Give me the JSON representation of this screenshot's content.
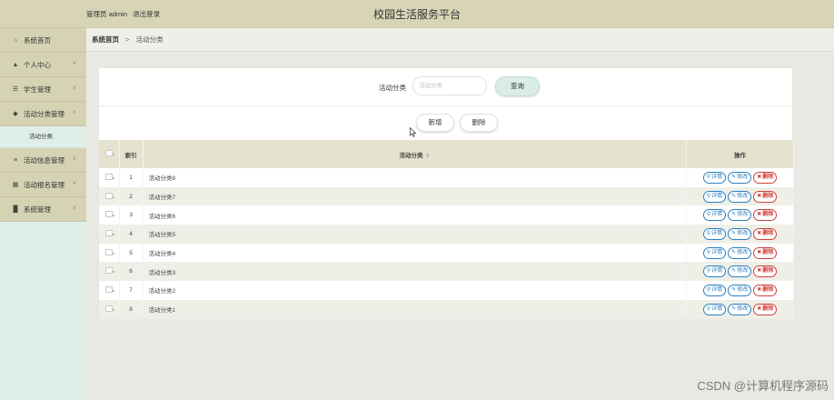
{
  "header": {
    "user_role": "管理员 admin",
    "logout": "退出登录",
    "title": "校园生活服务平台"
  },
  "sidebar": {
    "items": [
      {
        "label": "系统首页",
        "icon": "home-icon",
        "glyph": "⌂"
      },
      {
        "label": "个人中心",
        "icon": "user-icon",
        "glyph": "▴"
      },
      {
        "label": "学生管理",
        "icon": "student-icon",
        "glyph": "≡"
      },
      {
        "label": "活动分类管理",
        "icon": "category-icon",
        "glyph": "◆"
      },
      {
        "label": "活动信息管理",
        "icon": "sliders-icon",
        "glyph": "≣"
      },
      {
        "label": "活动报名管理",
        "icon": "bank-icon",
        "glyph": "⌂"
      },
      {
        "label": "系统管理",
        "icon": "chart-icon",
        "glyph": "▐"
      }
    ],
    "expanded_sub": "活动分类",
    "chevron_down": "∨",
    "chevron_up": "∧"
  },
  "breadcrumb": {
    "home": "系统首页",
    "separator": ">",
    "current": "活动分类"
  },
  "search": {
    "label": "活动分类",
    "placeholder": "活动分类",
    "button": "查询"
  },
  "actions": {
    "add": "新增",
    "delete": "删除"
  },
  "table": {
    "headers": {
      "index": "索引",
      "name": "活动分类",
      "sort_icon": "⇅",
      "ops": "操作"
    },
    "rows": [
      {
        "index": "1",
        "name": "活动分类8"
      },
      {
        "index": "2",
        "name": "活动分类7"
      },
      {
        "index": "3",
        "name": "活动分类6"
      },
      {
        "index": "4",
        "name": "活动分类5"
      },
      {
        "index": "5",
        "name": "活动分类4"
      },
      {
        "index": "6",
        "name": "活动分类3"
      },
      {
        "index": "7",
        "name": "活动分类2"
      },
      {
        "index": "8",
        "name": "活动分类1"
      }
    ],
    "row_actions": {
      "detail": "详情",
      "edit": "修改",
      "delete": "删除"
    }
  },
  "watermark": "CSDN @计算机程序源码"
}
